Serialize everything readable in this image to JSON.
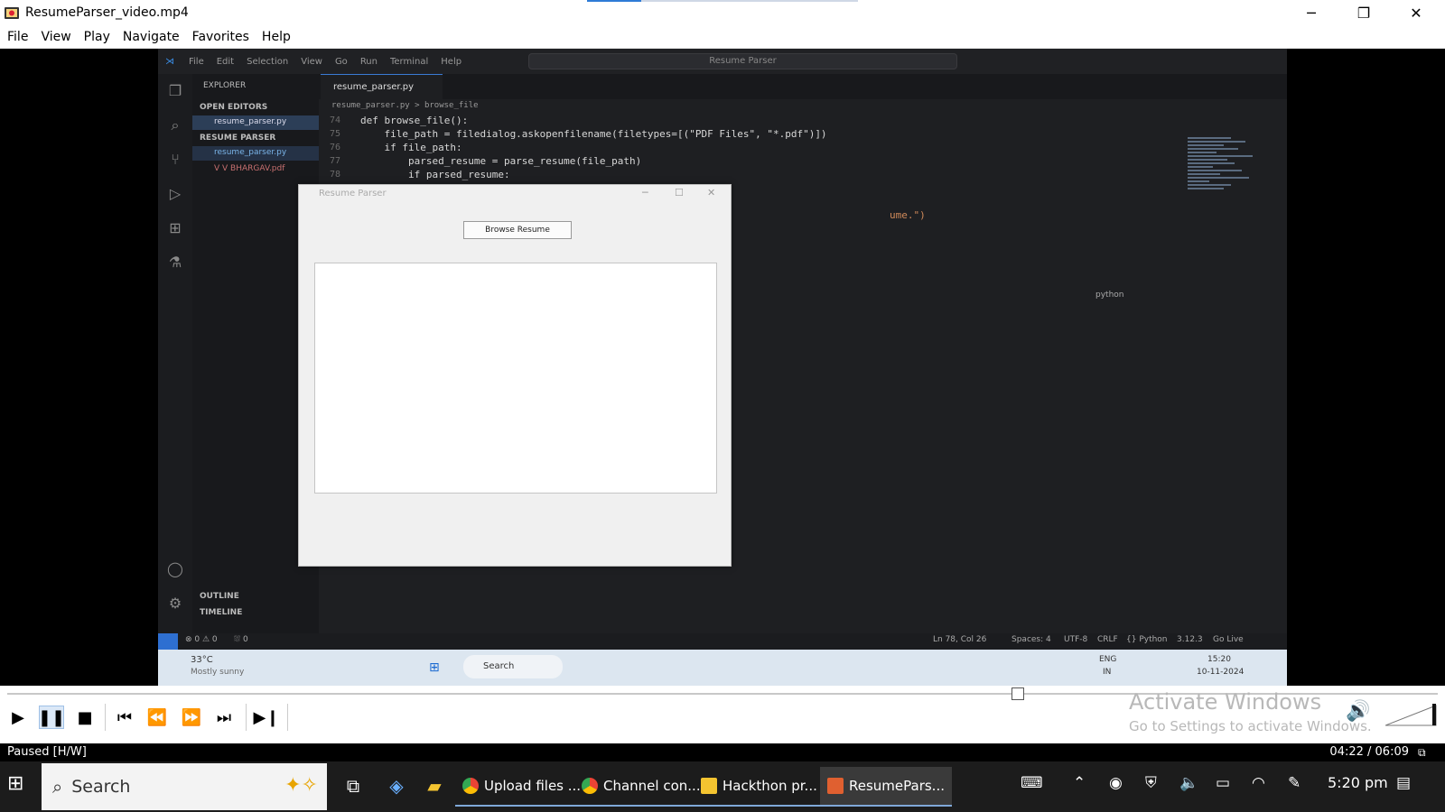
{
  "window": {
    "title": "ResumeParser_video.mp4",
    "controls": {
      "minimize": "─",
      "restore": "❐",
      "close": "✕"
    }
  },
  "menu": {
    "items": [
      "File",
      "View",
      "Play",
      "Navigate",
      "Favorites",
      "Help"
    ]
  },
  "video_frame": {
    "vscode": {
      "menu": [
        "File",
        "Edit",
        "Selection",
        "View",
        "Go",
        "Run",
        "Terminal",
        "Help"
      ],
      "search": "Resume Parser",
      "explorer_title": "EXPLORER",
      "open_editors": "OPEN EDITORS",
      "open_file": "resume_parser.py",
      "project": "RESUME PARSER",
      "files": [
        "resume_parser.py",
        "V V BHARGAV.pdf"
      ],
      "outline": "OUTLINE",
      "timeline": "TIMELINE",
      "tab": "resume_parser.py",
      "breadcrumb": "resume_parser.py > browse_file",
      "code": [
        {
          "ln": "74",
          "text": "def browse_file():"
        },
        {
          "ln": "75",
          "text": "    file_path = filedialog.askopenfilename(filetypes=[(\"PDF Files\", \"*.pdf\")])"
        },
        {
          "ln": "76",
          "text": "    if file_path:"
        },
        {
          "ln": "77",
          "text": "        parsed_resume = parse_resume(file_path)"
        },
        {
          "ln": "78",
          "text": "        if parsed_resume:"
        }
      ],
      "code_fragment": "ume.\")",
      "panel_label": "python",
      "status": {
        "problems": "⊗ 0 ⚠ 0",
        "ports": "⛆ 0",
        "cursor": "Ln 78, Col 26",
        "spaces": "Spaces: 4",
        "encoding": "UTF-8",
        "eol": "CRLF",
        "language": "{} Python",
        "version": "3.12.3",
        "golive": "Go Live"
      },
      "inner_taskbar": {
        "weather_temp": "33°C",
        "weather_desc": "Mostly sunny",
        "search": "Search",
        "lang": "ENG",
        "region": "IN",
        "time": "15:20",
        "date": "10-11-2024"
      }
    },
    "dialog": {
      "title": "Resume Parser",
      "browse_button": "Browse Resume"
    }
  },
  "player": {
    "watermark_line1": "Activate Windows",
    "watermark_line2": "Go to Settings to activate Windows.",
    "seek_progress": 0.7066,
    "status_left": "Paused [H/W]",
    "status_right": "04:22 / 06:09"
  },
  "taskbar": {
    "search_label": "Search",
    "apps": [
      {
        "label": "Upload files ...",
        "color": "#34a853"
      },
      {
        "label": "Channel con...",
        "color": "#4285f4"
      },
      {
        "label": "Hackthon pr...",
        "color": "#f4c430"
      },
      {
        "label": "ResumePars...",
        "color": "#e06030"
      }
    ],
    "time": "5:20 pm"
  },
  "colors": {
    "accent": "#2e7bd6",
    "vscode_bg": "#1e1f22"
  }
}
